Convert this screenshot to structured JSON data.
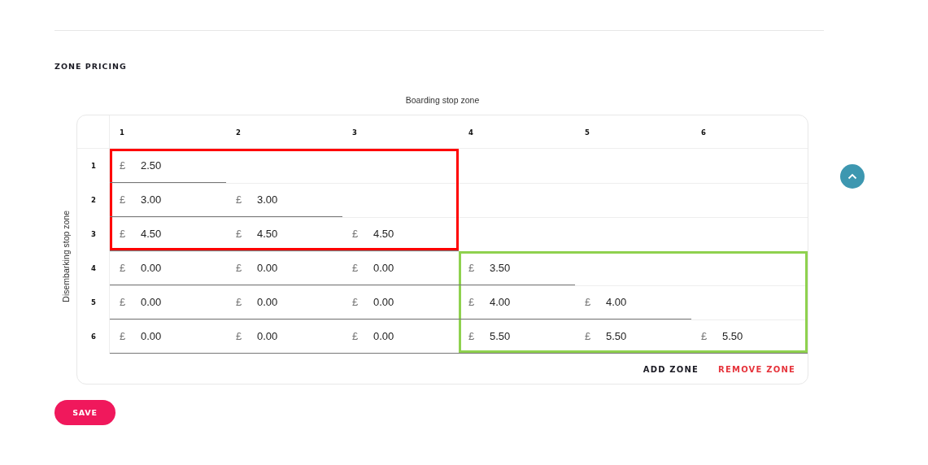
{
  "section": {
    "title": "ZONE PRICING"
  },
  "matrix": {
    "column_axis_label": "Boarding stop zone",
    "row_axis_label": "Disembarking stop zone",
    "columns": [
      "1",
      "2",
      "3",
      "4",
      "5",
      "6"
    ],
    "rows": [
      {
        "label": "1",
        "cells": [
          {
            "kind": "price",
            "currency": "£",
            "value": "2.50",
            "color": "#ff0000"
          },
          {
            "kind": "empty",
            "color": "#ff0000"
          },
          {
            "kind": "empty",
            "color": "#ff0000"
          }
        ]
      },
      {
        "label": "2",
        "cells": [
          {
            "kind": "price",
            "currency": "£",
            "value": "3.00",
            "color": "#ff0000"
          },
          {
            "kind": "price",
            "currency": "£",
            "value": "3.00"
          },
          {
            "kind": "empty",
            "color": "#ff0000"
          }
        ]
      },
      {
        "label": "3",
        "cells": [
          {
            "kind": "price",
            "currency": "£",
            "value": "4.50",
            "color": "#ff0000"
          },
          {
            "kind": "price",
            "currency": "£",
            "value": "4.50",
            "color": "#ff0000"
          },
          {
            "kind": "price",
            "currency": "£",
            "value": "4.50",
            "color": "#ff0000"
          }
        ]
      },
      {
        "label": "4",
        "cells": [
          {
            "kind": "price",
            "currency": "£",
            "value": "0.00"
          },
          {
            "kind": "price",
            "currency": "£",
            "value": "0.00"
          },
          {
            "kind": "price",
            "currency": "£",
            "value": "0.00"
          },
          {
            "kind": "price",
            "currency": "£",
            "value": "3.50",
            "color": "#8fd14f"
          },
          {
            "kind": "empty",
            "color": "#8fd14f"
          },
          {
            "kind": "empty",
            "color": "#8fd14f"
          }
        ]
      },
      {
        "label": "5",
        "cells": [
          {
            "kind": "price",
            "currency": "£",
            "value": "0.00"
          },
          {
            "kind": "price",
            "currency": "£",
            "value": "0.00"
          },
          {
            "kind": "price",
            "currency": "£",
            "value": "0.00"
          },
          {
            "kind": "price",
            "currency": "£",
            "value": "4.00",
            "color": "#8fd14f"
          },
          {
            "kind": "price",
            "currency": "£",
            "value": "4.00"
          },
          {
            "kind": "empty",
            "color": "#8fd14f"
          }
        ]
      },
      {
        "label": "6",
        "cells": [
          {
            "kind": "price",
            "currency": "£",
            "value": "0.00"
          },
          {
            "kind": "price",
            "currency": "£",
            "value": "0.00"
          },
          {
            "kind": "price",
            "currency": "£",
            "value": "0.00"
          },
          {
            "kind": "price",
            "currency": "£",
            "value": "5.50",
            "color": "#8fd14f"
          },
          {
            "kind": "price",
            "currency": "£",
            "value": "5.50",
            "color": "#8fd14f"
          },
          {
            "kind": "price",
            "currency": "£",
            "value": "5.50",
            "color": "#8fd14f"
          }
        ]
      }
    ],
    "actions": [
      {
        "label": "ADD ZONE",
        "kind": "neutral"
      },
      {
        "label": "REMOVE ZONE",
        "kind": "danger"
      }
    ]
  },
  "save_button": {
    "label": "SAVE"
  }
}
